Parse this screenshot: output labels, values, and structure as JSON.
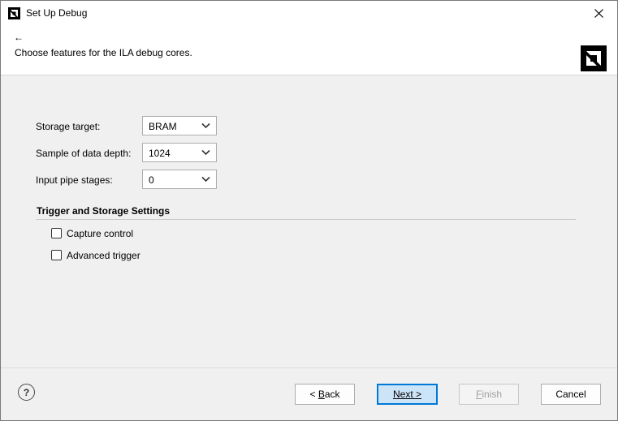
{
  "window": {
    "title": "Set Up Debug"
  },
  "header": {
    "back_glyph": "←",
    "description": "Choose features for the ILA debug cores."
  },
  "form": {
    "storage_target": {
      "label": "Storage target:",
      "value": "BRAM"
    },
    "sample_depth": {
      "label": "Sample of data depth:",
      "value": "1024"
    },
    "input_pipe": {
      "label": "Input pipe stages:",
      "value": "0"
    }
  },
  "section": {
    "title": "Trigger and Storage Settings",
    "checkboxes": [
      {
        "label": "Capture control",
        "checked": false
      },
      {
        "label": "Advanced trigger",
        "checked": false
      }
    ]
  },
  "footer": {
    "help": "?",
    "back": {
      "prefix": "< ",
      "mnemonic": "B",
      "rest": "ack"
    },
    "next": {
      "mnemonic": "N",
      "rest": "ext >"
    },
    "finish": {
      "mnemonic": "F",
      "rest": "inish"
    },
    "cancel": "Cancel"
  },
  "colors": {
    "accent": "#0078d7",
    "brand": "#000000",
    "disabled_text": "#a0a0a0"
  },
  "icons": {
    "title": "amd-logo-icon",
    "close": "close-icon",
    "chevron": "chevron-down-icon"
  }
}
